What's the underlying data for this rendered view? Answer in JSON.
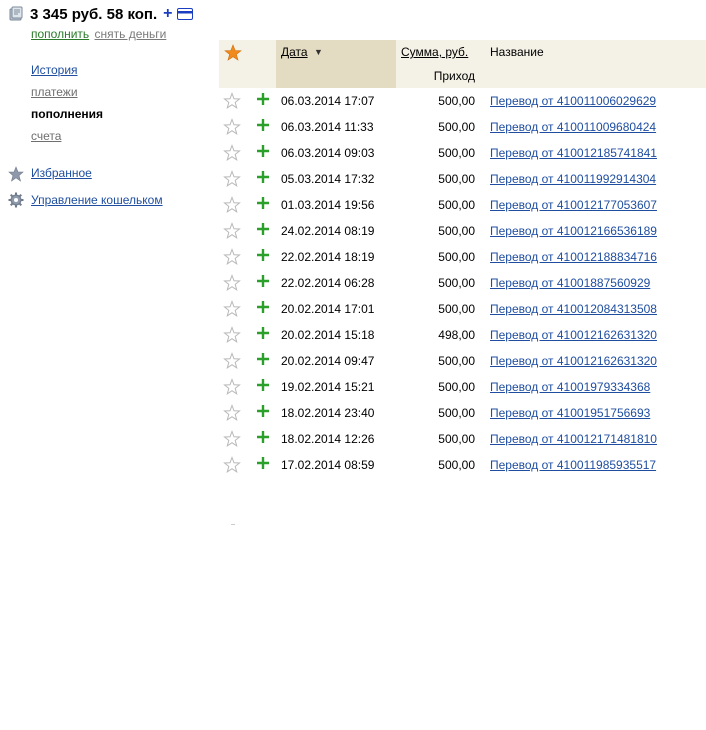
{
  "balance": {
    "amount": "3 345 руб. 58 коп.",
    "add_symbol": "+"
  },
  "quick_links": {
    "topup": "пополнить",
    "withdraw": "снять деньги"
  },
  "sidebar": {
    "items": [
      {
        "label": "История",
        "style": "link"
      },
      {
        "label": "платежи",
        "style": "gray"
      },
      {
        "label": "пополнения",
        "style": "active"
      },
      {
        "label": "счета",
        "style": "gray"
      }
    ],
    "favorites": "Избранное",
    "wallet_settings": "Управление кошельком"
  },
  "table": {
    "headers": {
      "date": "Дата",
      "sort_indicator": "▼",
      "sum": "Сумма, руб.",
      "sum_sub": "Приход",
      "name": "Название"
    },
    "rows": [
      {
        "date": "06.03.2014 17:07",
        "amount": "500,00",
        "name": "Перевод от 410011006029629"
      },
      {
        "date": "06.03.2014 11:33",
        "amount": "500,00",
        "name": "Перевод от 410011009680424"
      },
      {
        "date": "06.03.2014 09:03",
        "amount": "500,00",
        "name": "Перевод от 410012185741841"
      },
      {
        "date": "05.03.2014 17:32",
        "amount": "500,00",
        "name": "Перевод от 410011992914304"
      },
      {
        "date": "01.03.2014 19:56",
        "amount": "500,00",
        "name": "Перевод от 410012177053607"
      },
      {
        "date": "24.02.2014 08:19",
        "amount": "500,00",
        "name": "Перевод от 410012166536189"
      },
      {
        "date": "22.02.2014 18:19",
        "amount": "500,00",
        "name": "Перевод от 410012188834716"
      },
      {
        "date": "22.02.2014 06:28",
        "amount": "500,00",
        "name": "Перевод от 41001887560929"
      },
      {
        "date": "20.02.2014 17:01",
        "amount": "500,00",
        "name": "Перевод от 410012084313508"
      },
      {
        "date": "20.02.2014 15:18",
        "amount": "498,00",
        "name": "Перевод от 410012162631320"
      },
      {
        "date": "20.02.2014 09:47",
        "amount": "500,00",
        "name": "Перевод от 410012162631320"
      },
      {
        "date": "19.02.2014 15:21",
        "amount": "500,00",
        "name": "Перевод от 41001979334368"
      },
      {
        "date": "18.02.2014 23:40",
        "amount": "500,00",
        "name": "Перевод от 41001951756693"
      },
      {
        "date": "18.02.2014 12:26",
        "amount": "500,00",
        "name": "Перевод от 410012171481810"
      },
      {
        "date": "17.02.2014 08:59",
        "amount": "500,00",
        "name": "Перевод от 410011985935517"
      }
    ]
  },
  "colors": {
    "link": "#1f4ea0",
    "income_plus": "#2aa02a",
    "header_star": "#f08a1c",
    "header_bg": "#f4f1e6",
    "sorted_column_bg": "#e4dcc2"
  }
}
